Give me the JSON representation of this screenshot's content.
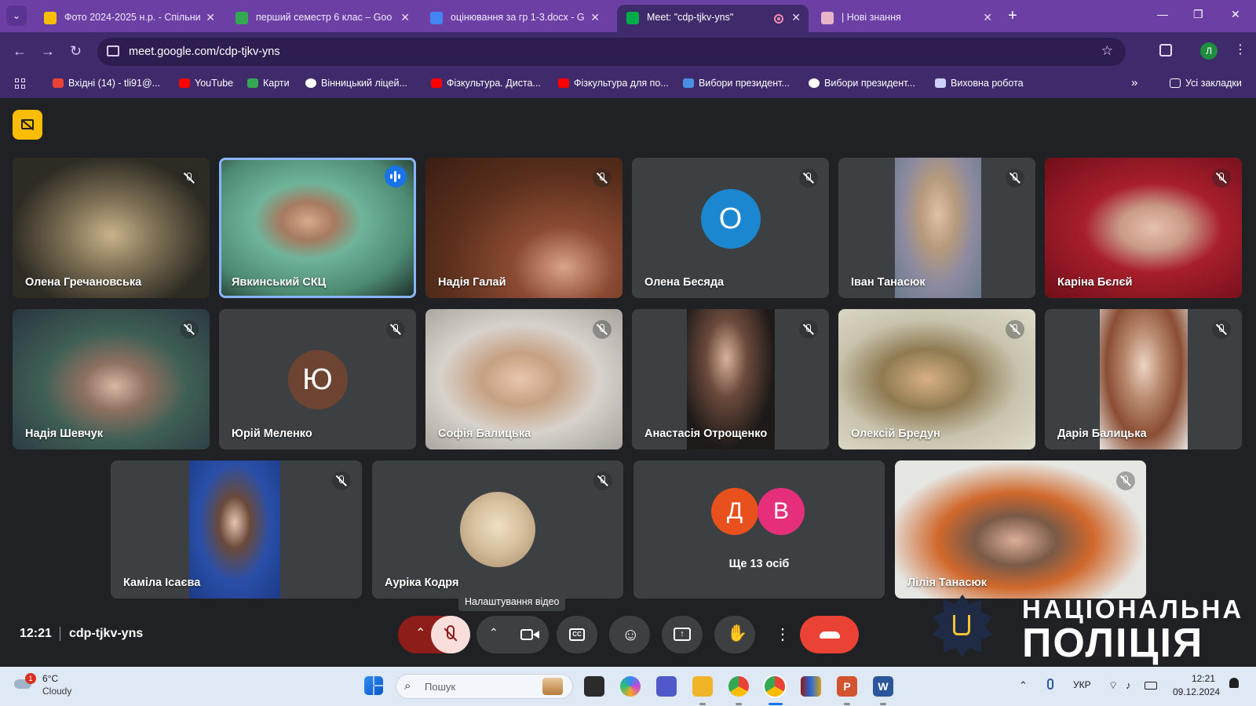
{
  "browser": {
    "tabs": [
      {
        "title": "Фото 2024-2025 н.р. - Спільни",
        "icon": "google-drive-icon",
        "color": "#fbbc04"
      },
      {
        "title": "перший семестр 6 клас – Goo",
        "icon": "google-drive-icon",
        "color": "#34a853"
      },
      {
        "title": "оцінювання за гр 1-3.docx - G",
        "icon": "google-docs-icon",
        "color": "#4285f4"
      },
      {
        "title": "Meet: \"cdp-tjkv-yns\"",
        "icon": "google-meet-icon",
        "color": "#00ac47",
        "active": true,
        "recording": true
      },
      {
        "title": "| Нові знання",
        "icon": "site-icon",
        "color": "#e8b4c8"
      }
    ],
    "url": "meet.google.com/cdp-tjkv-yns",
    "profile_initial": "Л",
    "bookmarks": [
      {
        "label": "Вхідні (14) - tli91@...",
        "icon": "gmail-icon",
        "color": "#ea4335"
      },
      {
        "label": "YouTube",
        "icon": "youtube-icon",
        "color": "#ff0000"
      },
      {
        "label": "Карти",
        "icon": "maps-icon",
        "color": "#34a853"
      },
      {
        "label": "Вінницький ліцей...",
        "icon": "globe-icon",
        "color": "#ffffff"
      },
      {
        "label": "Фізкультура. Диста...",
        "icon": "youtube-icon",
        "color": "#ff0000"
      },
      {
        "label": "Фізкультура для по...",
        "icon": "youtube-icon",
        "color": "#ff0000"
      },
      {
        "label": "Вибори президент...",
        "icon": "site-icon",
        "color": "#4a90e2"
      },
      {
        "label": "Вибори президент...",
        "icon": "wordpress-icon",
        "color": "#ffffff"
      },
      {
        "label": "Виховна робота",
        "icon": "site-icon",
        "color": "#d0d0ff"
      }
    ],
    "all_bookmarks": "Усі закладки"
  },
  "meeting": {
    "participants": [
      {
        "name": "Олена Гречановська",
        "muted": true,
        "video": true,
        "bg": "#6f6a55"
      },
      {
        "name": "Явкинський СКЦ",
        "muted": false,
        "speaking": true,
        "video": true,
        "bg": "#5a8a78"
      },
      {
        "name": "Надія Галай",
        "muted": true,
        "video": true,
        "bg": "#6a3b22"
      },
      {
        "name": "Олена Бесяда",
        "muted": true,
        "video": false,
        "initial": "О",
        "avatar_color": "#1a87d0"
      },
      {
        "name": "Іван Танасюк",
        "muted": true,
        "video": true,
        "bg": "#b7a88c"
      },
      {
        "name": "Каріна Бєлєй",
        "muted": true,
        "video": true,
        "bg": "#9a1e28"
      },
      {
        "name": "Надія Шевчук",
        "muted": true,
        "video": true,
        "bg": "#42586a"
      },
      {
        "name": "Юрій Меленко",
        "muted": true,
        "video": false,
        "initial": "Ю",
        "avatar_color": "#6d4332"
      },
      {
        "name": "Софія Балицька",
        "muted": true,
        "video": true,
        "bg": "#cfc7bf"
      },
      {
        "name": "Анастасія Отрощенко",
        "muted": true,
        "video": true,
        "bg": "#2a2422"
      },
      {
        "name": "Олексій Бредун",
        "muted": true,
        "video": true,
        "bg": "#b8b29a"
      },
      {
        "name": "Дарія Балицька",
        "muted": true,
        "video": true,
        "bg": "#c9b6ac"
      },
      {
        "name": "Каміла Ісаєва",
        "muted": true,
        "video": true,
        "bg": "#4a5a7a"
      },
      {
        "name": "Аурiка Кодря",
        "muted": true,
        "video": false,
        "avatar_photo": true,
        "avatar_color": "#c9b59a"
      },
      {
        "name": "Лілія Танасюк",
        "muted": true,
        "video": true,
        "bg": "#c8c8c4"
      }
    ],
    "others": {
      "initials": [
        "Д",
        "В"
      ],
      "colors": [
        "#e8501d",
        "#e52f7b"
      ],
      "label": "Ще 13 осіб"
    },
    "time": "12:21",
    "code": "cdp-tjkv-yns",
    "tooltip": "Налаштування відео",
    "watermark": {
      "line1": "НАЦІОНАЛЬНА",
      "line2": "ПОЛІЦІЯ"
    }
  },
  "taskbar": {
    "weather": {
      "temp": "6°C",
      "condition": "Cloudy",
      "alert": "1"
    },
    "search_placeholder": "Пошук",
    "language": "УКР",
    "clock_time": "12:21",
    "clock_date": "09.12.2024"
  }
}
